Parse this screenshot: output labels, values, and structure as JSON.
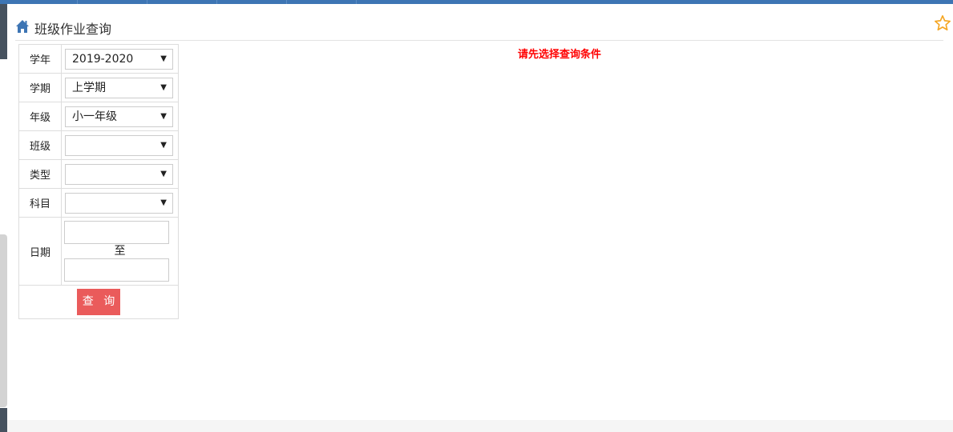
{
  "header": {
    "title": "班级作业查询",
    "home_icon": "home-icon",
    "favorite_icon": "star-icon",
    "accent": "#3d75b4",
    "star_color": "#f5a623"
  },
  "message": "请先选择查询条件",
  "form": {
    "fields": [
      {
        "label": "学年",
        "value": "2019-2020"
      },
      {
        "label": "学期",
        "value": "上学期"
      },
      {
        "label": "年级",
        "value": "小一年级"
      },
      {
        "label": "班级",
        "value": ""
      },
      {
        "label": "类型",
        "value": ""
      },
      {
        "label": "科目",
        "value": ""
      }
    ],
    "date": {
      "label": "日期",
      "separator": "至",
      "start": "",
      "end": ""
    },
    "submit_label": "查 询",
    "submit_color": "#ea5b5b"
  }
}
